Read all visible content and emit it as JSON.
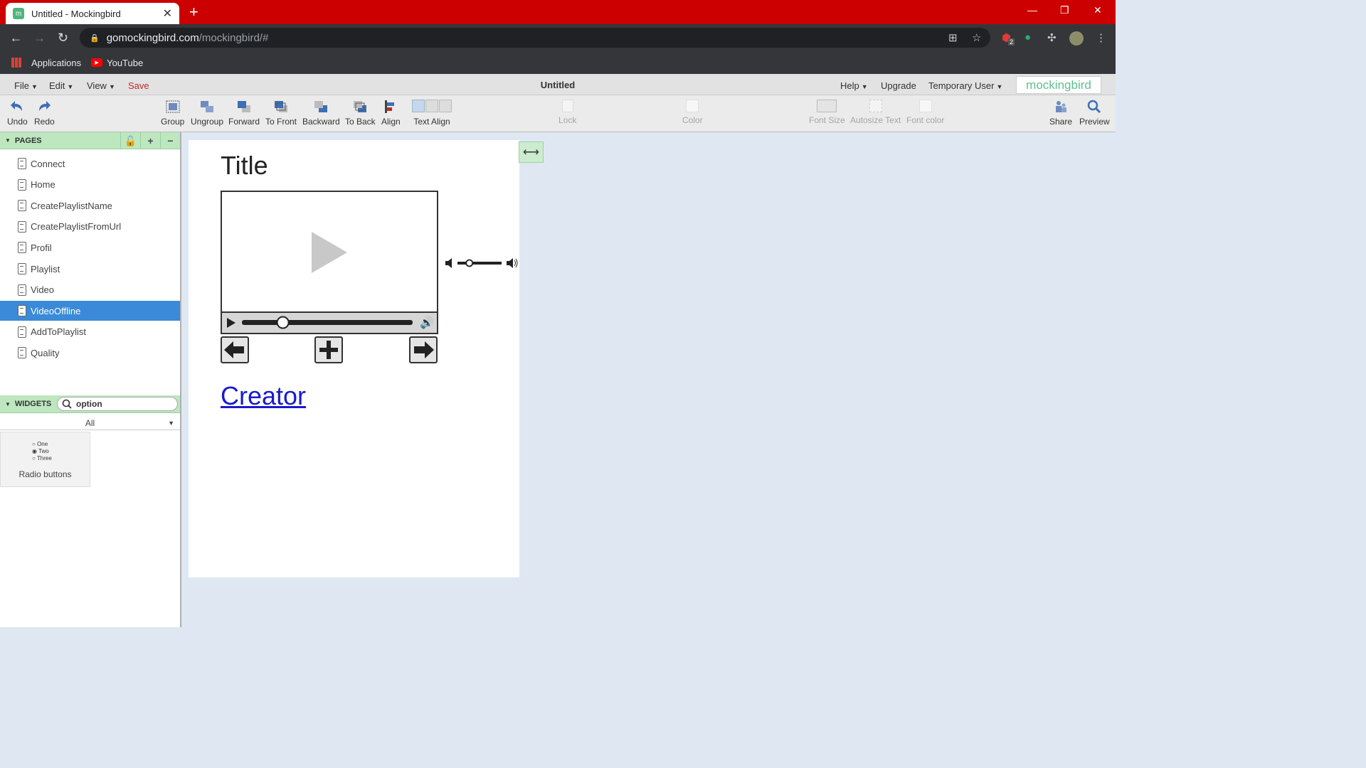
{
  "browser": {
    "tab_title": "Untitled - Mockingbird",
    "favicon_letter": "m",
    "new_tab": "+",
    "url_domain": "gomockingbird.com",
    "url_path": "/mockingbird/#",
    "extension_badge": "2",
    "bookmarks": [
      "Applications",
      "YouTube"
    ]
  },
  "menu": {
    "file": "File",
    "edit": "Edit",
    "view": "View",
    "save": "Save",
    "doc_title": "Untitled",
    "help": "Help",
    "upgrade": "Upgrade",
    "user": "Temporary User",
    "brand": "mockingbird"
  },
  "toolbar": {
    "undo": "Undo",
    "redo": "Redo",
    "group": "Group",
    "ungroup": "Ungroup",
    "forward": "Forward",
    "to_front": "To Front",
    "backward": "Backward",
    "to_back": "To Back",
    "align": "Align",
    "text_align": "Text Align",
    "lock": "Lock",
    "color": "Color",
    "font_size": "Font Size",
    "autosize_text": "Autosize Text",
    "font_color": "Font color",
    "share": "Share",
    "preview": "Preview"
  },
  "pages_panel": {
    "header": "PAGES",
    "pages": [
      "Connect",
      "Home",
      "CreatePlaylistName",
      "CreatePlaylistFromUrl",
      "Profil",
      "Playlist",
      "Video",
      "VideoOffline",
      "AddToPlaylist",
      "Quality"
    ],
    "selected": "VideoOffline"
  },
  "widgets_panel": {
    "header": "WIDGETS",
    "search_value": "option",
    "filter": "All",
    "tile_options": [
      "One",
      "Two",
      "Three"
    ],
    "tile_selected": "Two",
    "tile_label": "Radio buttons"
  },
  "canvas": {
    "title": "Title",
    "link": "Creator",
    "video_progress": 0.24,
    "volume_level": 0.27
  },
  "colors": {
    "tabbar": "#cc0000",
    "panel_header": "#bde7bf",
    "selection": "#3a8ad8",
    "canvas_bg": "#dfe8f2",
    "save": "#c62828",
    "link": "#1a1acc",
    "brand": "#5fbf8f"
  }
}
